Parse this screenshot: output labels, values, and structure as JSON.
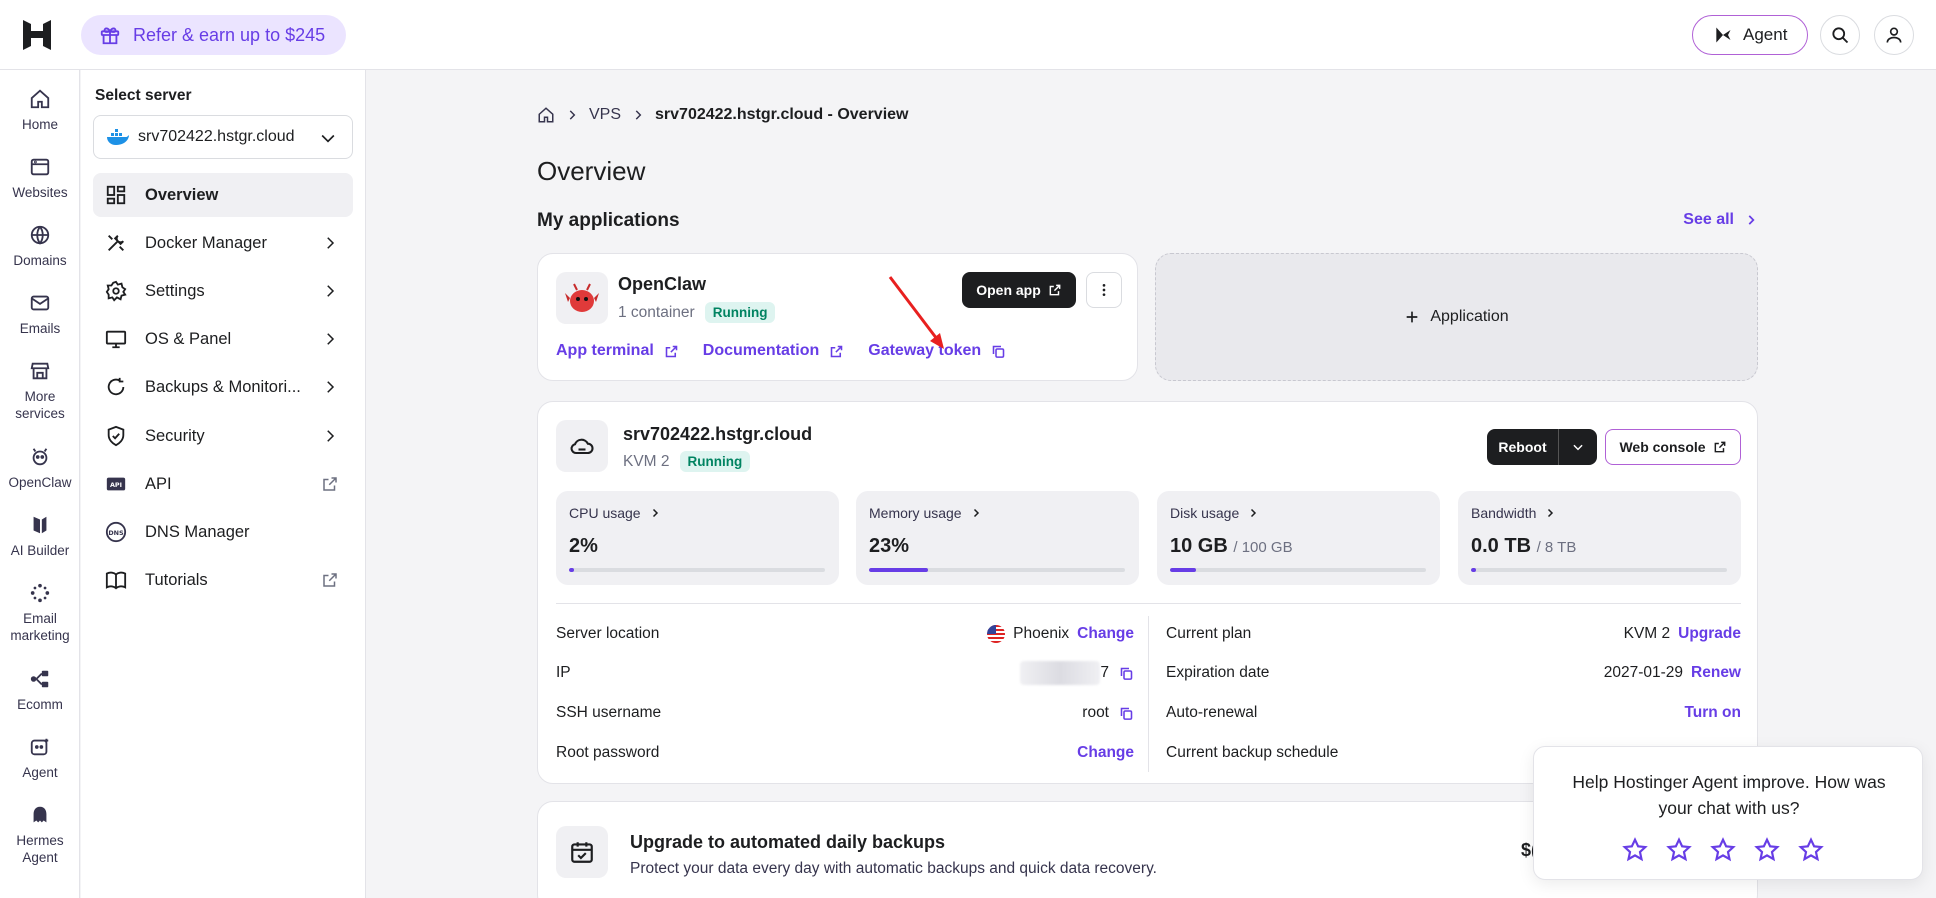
{
  "topbar": {
    "refer_label": "Refer & earn up to $245",
    "agent_label": "Agent"
  },
  "rail": [
    {
      "label": "Home",
      "icon": "home-icon"
    },
    {
      "label": "Websites",
      "icon": "websites-icon"
    },
    {
      "label": "Domains",
      "icon": "globe-icon"
    },
    {
      "label": "Emails",
      "icon": "mail-icon"
    },
    {
      "label": "More services",
      "icon": "store-icon"
    },
    {
      "label": "OpenClaw",
      "icon": "openclaw-icon"
    },
    {
      "label": "AI Builder",
      "icon": "ai-builder-icon"
    },
    {
      "label": "Email marketing",
      "icon": "email-marketing-icon"
    },
    {
      "label": "Ecomm",
      "icon": "ecomm-icon"
    },
    {
      "label": "Agent",
      "icon": "agent-icon"
    },
    {
      "label": "Hermes Agent",
      "icon": "hermes-icon"
    }
  ],
  "panel": {
    "title": "Select server",
    "server": "srv702422.hstgr.cloud",
    "nav": [
      {
        "label": "Overview",
        "icon": "overview-icon"
      },
      {
        "label": "Docker Manager",
        "icon": "docker-manager-icon"
      },
      {
        "label": "Settings",
        "icon": "gear-icon"
      },
      {
        "label": "OS & Panel",
        "icon": "monitor-icon"
      },
      {
        "label": "Backups & Monitori...",
        "icon": "backup-icon"
      },
      {
        "label": "Security",
        "icon": "shield-icon"
      },
      {
        "label": "API",
        "icon": "api-icon"
      },
      {
        "label": "DNS Manager",
        "icon": "dns-icon"
      },
      {
        "label": "Tutorials",
        "icon": "book-icon"
      }
    ]
  },
  "breadcrumb": {
    "vps": "VPS",
    "current": "srv702422.hstgr.cloud - Overview"
  },
  "page_title": "Overview",
  "apps": {
    "title": "My applications",
    "see_all": "See all",
    "app": {
      "name": "OpenClaw",
      "containers": "1 container",
      "status": "Running",
      "open_app": "Open app",
      "links": [
        "App terminal",
        "Documentation",
        "Gateway token"
      ]
    },
    "add_label": "Application"
  },
  "vps": {
    "name": "srv702422.hstgr.cloud",
    "plan": "KVM 2",
    "status": "Running",
    "reboot": "Reboot",
    "web_console": "Web console",
    "stats": [
      {
        "label": "CPU usage",
        "value": "2%",
        "sub": "",
        "fill_pct": 2
      },
      {
        "label": "Memory usage",
        "value": "23%",
        "sub": "",
        "fill_pct": 23
      },
      {
        "label": "Disk usage",
        "value": "10 GB",
        "sub": "/ 100 GB",
        "fill_pct": 10
      },
      {
        "label": "Bandwidth",
        "value": "0.0 TB",
        "sub": "/ 8 TB",
        "fill_pct": 0
      }
    ],
    "details_left": {
      "location_label": "Server location",
      "location_value": "Phoenix",
      "location_action": "Change",
      "ip_label": "IP",
      "ip_value": "7",
      "ssh_label": "SSH username",
      "ssh_value": "root",
      "root_label": "Root password",
      "root_action": "Change"
    },
    "details_right": {
      "plan_label": "Current plan",
      "plan_value": "KVM 2",
      "plan_action": "Upgrade",
      "exp_label": "Expiration date",
      "exp_value": "2027-01-29",
      "exp_action": "Renew",
      "renew_label": "Auto-renewal",
      "renew_action": "Turn on",
      "backup_label": "Current backup schedule"
    }
  },
  "backup_promo": {
    "title": "Upgrade to automated daily backups",
    "subtitle": "Protect your data every day with automatic backups and quick data recovery.",
    "price": "$("
  },
  "feedback": {
    "question": "Help Hostinger Agent improve. How was your chat with us?",
    "stars": 5
  },
  "colors": {
    "accent": "#673de6",
    "success_bg": "#def4f0",
    "success_text": "#008361",
    "annotation_arrow": "#e8201f"
  }
}
